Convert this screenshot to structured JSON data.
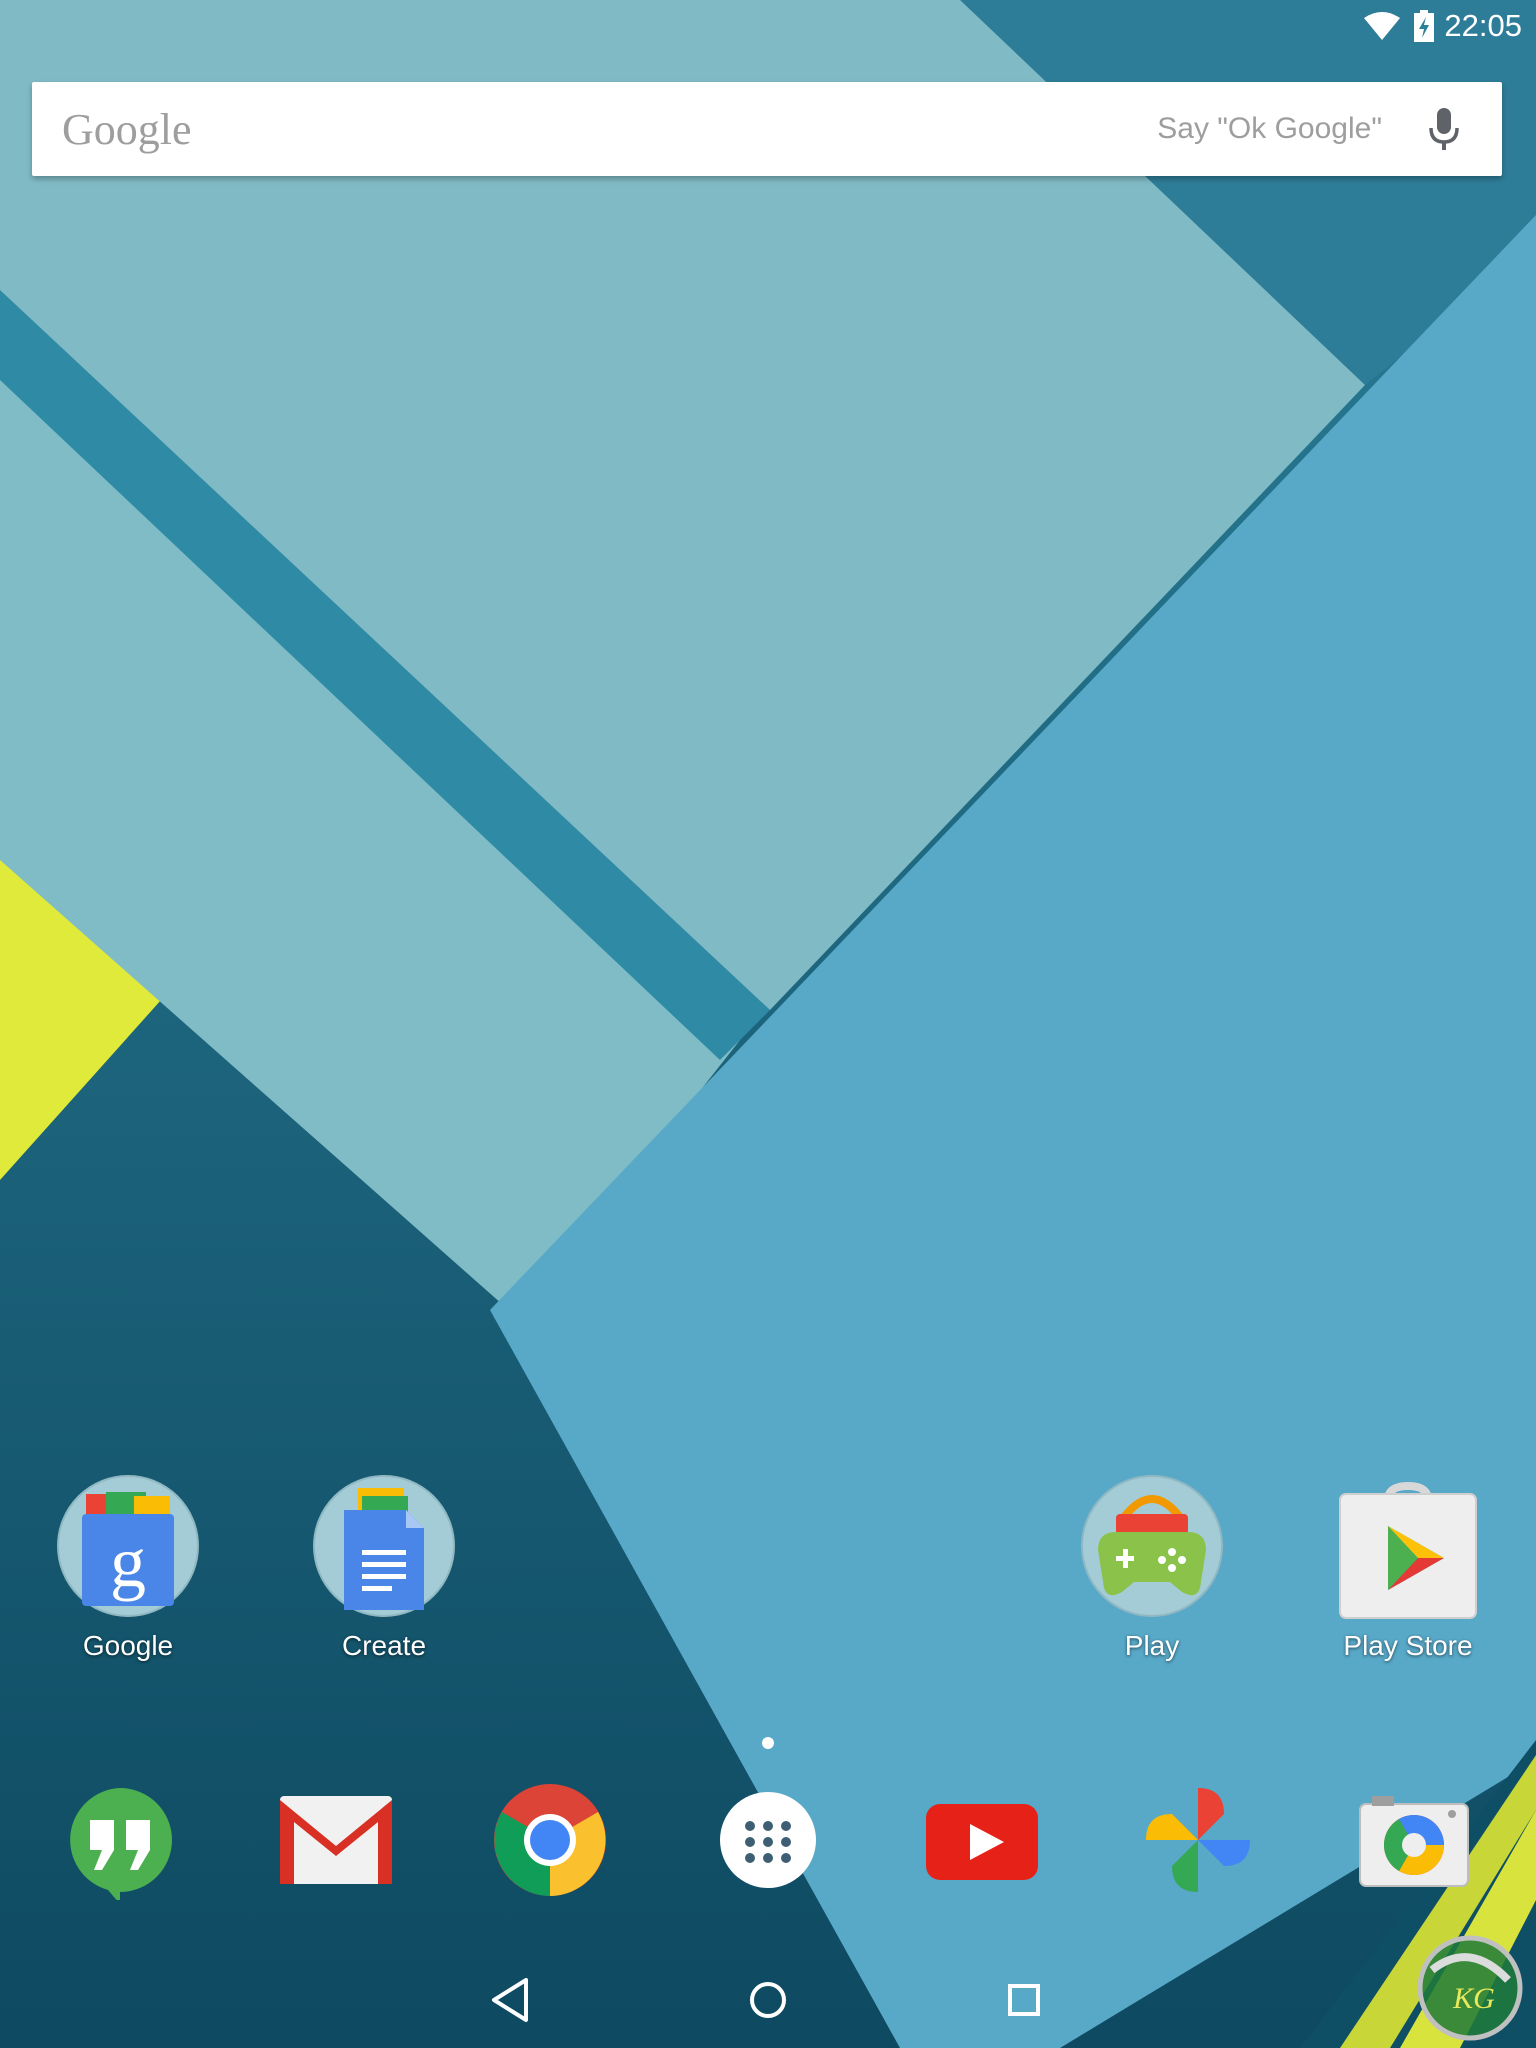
{
  "status_bar": {
    "time": "22:05",
    "icons": [
      "wifi-icon",
      "battery-charging-icon"
    ]
  },
  "search": {
    "logo": "Google",
    "hint": "Say \"Ok Google\"",
    "icon": "mic-icon"
  },
  "home_apps": [
    {
      "label": "Google",
      "icon": "google-folder-icon"
    },
    {
      "label": "Create",
      "icon": "create-folder-icon"
    },
    {
      "label": "Play",
      "icon": "play-folder-icon"
    },
    {
      "label": "Play Store",
      "icon": "play-store-icon"
    }
  ],
  "page_indicator": {
    "current": 1,
    "total": 1
  },
  "dock": [
    {
      "icon": "hangouts-icon"
    },
    {
      "icon": "gmail-icon"
    },
    {
      "icon": "chrome-icon"
    },
    {
      "icon": "app-drawer-icon"
    },
    {
      "icon": "youtube-icon"
    },
    {
      "icon": "photos-icon"
    },
    {
      "icon": "camera-icon"
    }
  ],
  "navigation": [
    "back-icon",
    "home-icon",
    "recents-icon"
  ],
  "watermark": "KG",
  "colors": {
    "wallpaper_dark": "#1f6a84",
    "wallpaper_light": "#7fbac6",
    "wallpaper_blue": "#55a7c6",
    "accent_yellow": "#dde43a"
  }
}
